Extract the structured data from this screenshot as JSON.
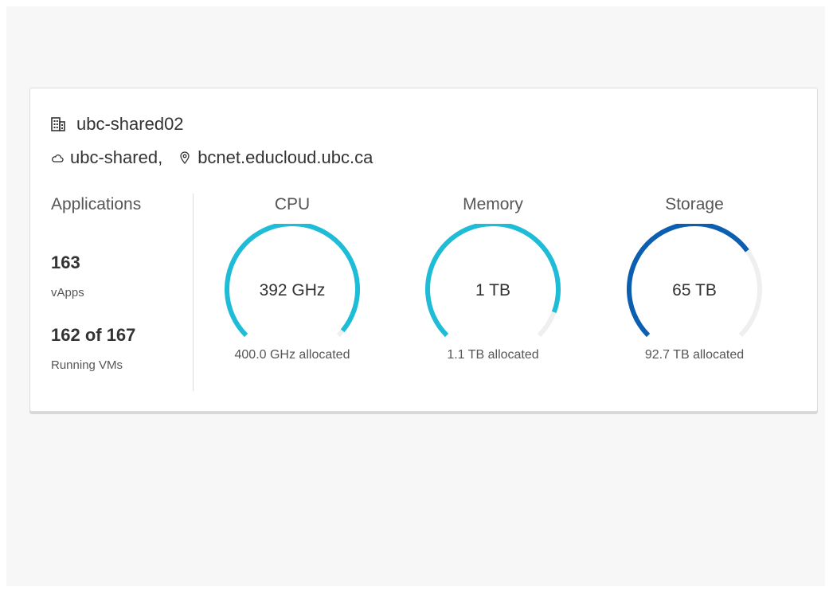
{
  "colors": {
    "cyan": "#1ebcd6",
    "blue": "#0b5eb0",
    "track": "#efefef",
    "text": "#333333",
    "muted": "#565656"
  },
  "header": {
    "title": "ubc-shared02",
    "title_icon": "building-icon",
    "site": "ubc-shared,",
    "site_icon": "cloud-icon",
    "location": "bcnet.educloud.ubc.ca",
    "location_icon": "location-pin-icon"
  },
  "applications": {
    "heading": "Applications",
    "vapps_count": "163",
    "vapps_label": "vApps",
    "vms_count": "162 of 167",
    "vms_label": "Running VMs"
  },
  "gauges": [
    {
      "title": "CPU",
      "value": "392 GHz",
      "allocated": "400.0 GHz allocated",
      "fraction": 0.98,
      "color": "#1ebcd6"
    },
    {
      "title": "Memory",
      "value": "1 TB",
      "allocated": "1.1 TB allocated",
      "fraction": 0.91,
      "color": "#1ebcd6"
    },
    {
      "title": "Storage",
      "value": "65 TB",
      "allocated": "92.7 TB allocated",
      "fraction": 0.7,
      "color": "#0b5eb0"
    }
  ]
}
